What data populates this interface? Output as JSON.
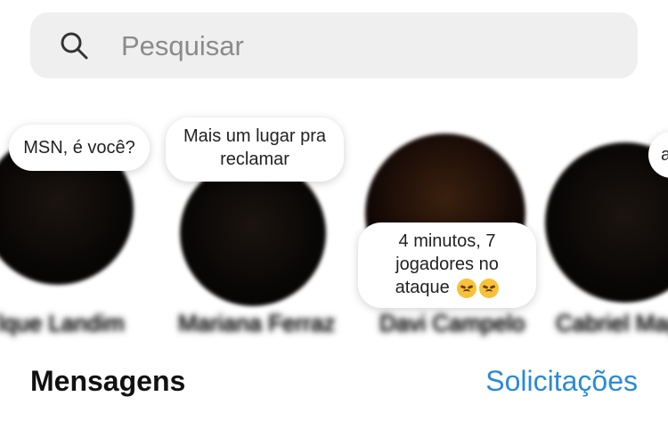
{
  "search": {
    "placeholder": "Pesquisar",
    "icon": "search-icon"
  },
  "notes": [
    {
      "note": "MSN, é você?",
      "name": "lque Landim"
    },
    {
      "note": "Mais um lugar pra reclamar",
      "name": "Mariana Ferraz"
    },
    {
      "note": "4 minutos, 7 jogadores no ataque",
      "name": "Davi Campelo"
    },
    {
      "note": "a",
      "name": "Cabriel Mag"
    }
  ],
  "messages": {
    "title": "Mensagens",
    "requests_label": "Solicitações",
    "requests_color": "#2a8ad9"
  }
}
